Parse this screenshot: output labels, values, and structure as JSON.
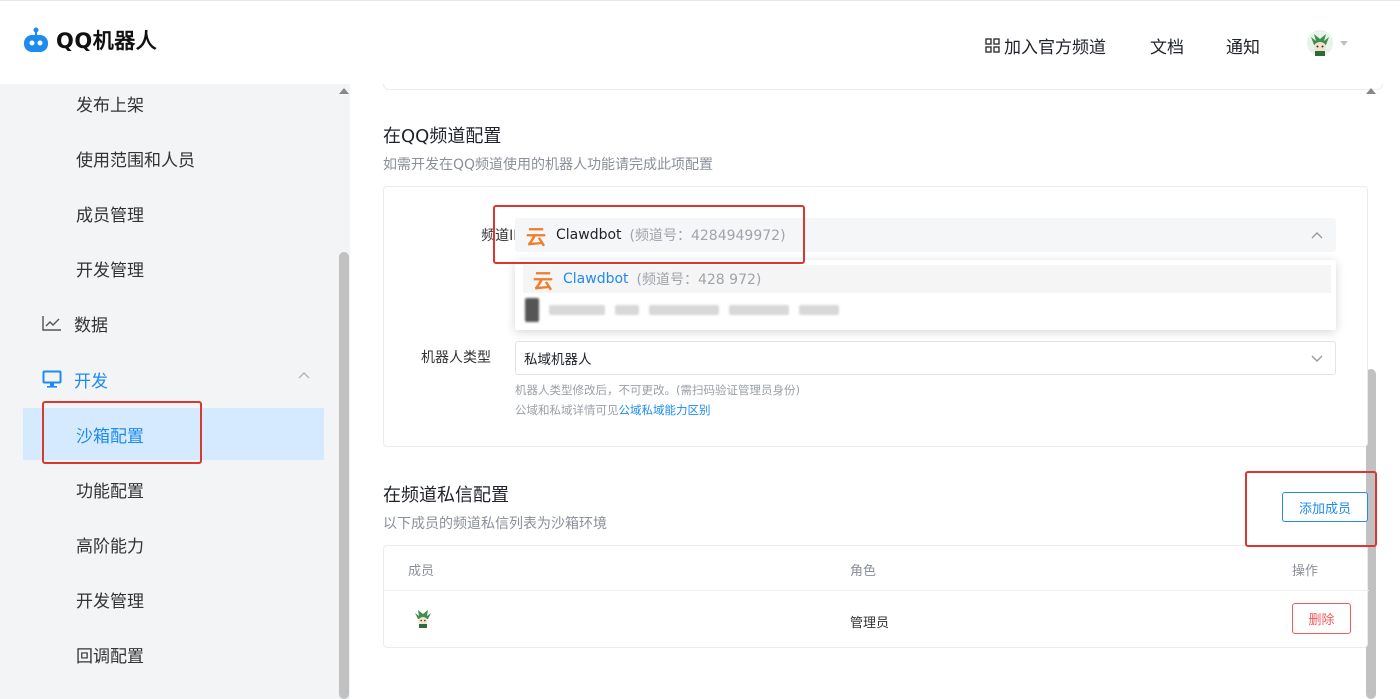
{
  "header": {
    "logo_text": "QQ机器人",
    "nav": {
      "join_channel": "加入官方频道",
      "docs": "文档",
      "notifications": "通知"
    }
  },
  "sidebar": {
    "items": [
      {
        "label": "发布上架"
      },
      {
        "label": "使用范围和人员"
      },
      {
        "label": "成员管理"
      },
      {
        "label": "开发管理"
      },
      {
        "label": "数据"
      },
      {
        "label": "开发"
      },
      {
        "label": "沙箱配置"
      },
      {
        "label": "功能配置"
      },
      {
        "label": "高阶能力"
      },
      {
        "label": "开发管理"
      },
      {
        "label": "回调配置"
      }
    ]
  },
  "channel_config": {
    "title": "在QQ频道配置",
    "description": "如需开发在QQ频道使用的机器人功能请完成此项配置",
    "channel_id_label": "频道ID",
    "selected_channel": {
      "icon": "云",
      "name": "Clawdbot",
      "number": "(频道号：4284949972)"
    },
    "dropdown_options": [
      {
        "icon": "云",
        "name": "Clawdbot",
        "number": "(频道号：428    972)"
      }
    ],
    "robot_type_label": "机器人类型",
    "robot_type_value": "私域机器人",
    "hint_line1": "机器人类型修改后，不可更改。(需扫码验证管理员身份)",
    "hint_line2_prefix": "公域和私域详情可见",
    "hint_link": "公域私域能力区别"
  },
  "dm_config": {
    "title": "在频道私信配置",
    "description": "以下成员的频道私信列表为沙箱环境",
    "add_member_button": "添加成员",
    "table": {
      "columns": [
        "成员",
        "角色",
        "操作"
      ],
      "rows": [
        {
          "role": "管理员",
          "action": "删除"
        }
      ]
    }
  },
  "colors": {
    "accent": "#1d8bf0",
    "danger": "#f25a5a",
    "brand_orange": "#f07d2a",
    "highlight_red": "#d9382e"
  }
}
